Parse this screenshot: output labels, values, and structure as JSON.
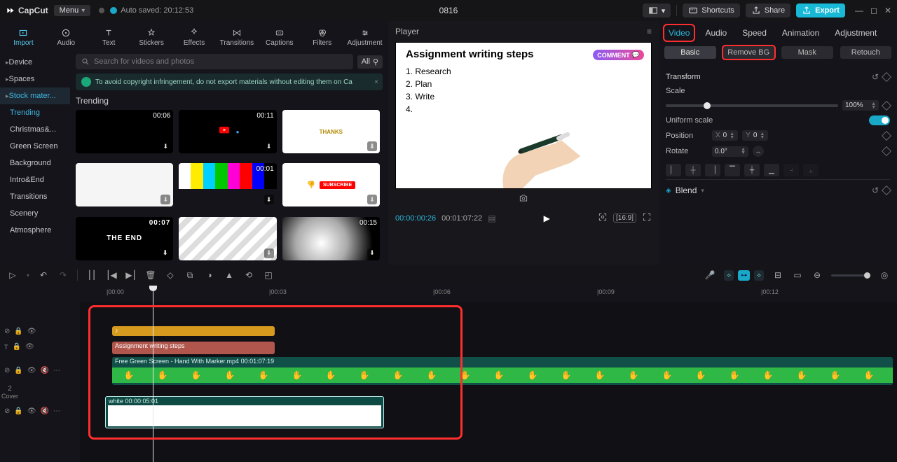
{
  "topbar": {
    "brand": "CapCut",
    "menu": "Menu",
    "autosaved": "Auto saved: 20:12:53",
    "title": "0816",
    "shortcuts": "Shortcuts",
    "share": "Share",
    "export": "Export"
  },
  "media_tabs": [
    "Import",
    "Audio",
    "Text",
    "Stickers",
    "Effects",
    "Transitions",
    "Captions",
    "Filters",
    "Adjustment"
  ],
  "left_sidebar": {
    "top": [
      "Device",
      "Spaces",
      "Stock mater..."
    ],
    "sub": [
      "Trending",
      "Christmas&...",
      "Green Screen",
      "Background",
      "Intro&End",
      "Transitions",
      "Scenery",
      "Atmosphere"
    ]
  },
  "search": {
    "placeholder": "Search for videos and photos",
    "all": "All"
  },
  "banner": {
    "text": "To avoid copyright infringement, do not export materials without editing them on Ca",
    "close": "×"
  },
  "section_label": "Trending",
  "thumbs": [
    {
      "dur": "00:06"
    },
    {
      "dur": "00:11"
    },
    {
      "dur": "",
      "label": "THANKS"
    },
    {
      "dur": ""
    },
    {
      "dur": "00:01"
    },
    {
      "dur": "",
      "label": "SUBSCRIBE"
    },
    {
      "dur": "00:07",
      "label": "THE END"
    },
    {
      "dur": ""
    },
    {
      "dur": "00:15"
    }
  ],
  "player": {
    "label": "Player",
    "slide_title": "Assignment writing steps",
    "slide_items": [
      "1. Research",
      "2. Plan",
      "3. Write",
      "4."
    ],
    "badge": "COMMENT",
    "time_current": "00:00:00:26",
    "time_total": "00:01:07:22",
    "ratio_chip": "[16:9]"
  },
  "inspector": {
    "tabs": [
      "Video",
      "Audio",
      "Speed",
      "Animation",
      "Adjustment"
    ],
    "subtabs": [
      "Basic",
      "Remove BG",
      "Mask",
      "Retouch"
    ],
    "transform": "Transform",
    "scale": "Scale",
    "scale_value": "100%",
    "uniform": "Uniform scale",
    "position": "Position",
    "pos_x": "0",
    "pos_y": "0",
    "rotate": "Rotate",
    "rotate_value": "0.0°",
    "blend": "Blend"
  },
  "tl_ruler": [
    "|00:00",
    "|00:03",
    "|00:06",
    "|00:09",
    "|00:12"
  ],
  "timeline": {
    "text_clip": "Assignment writing steps",
    "video_label": "Free Green Screen - Hand With Marker.mp4   00:01:07:19",
    "white_label": "white  00:00:05:01",
    "cover_num": "2",
    "cover": "Cover"
  }
}
